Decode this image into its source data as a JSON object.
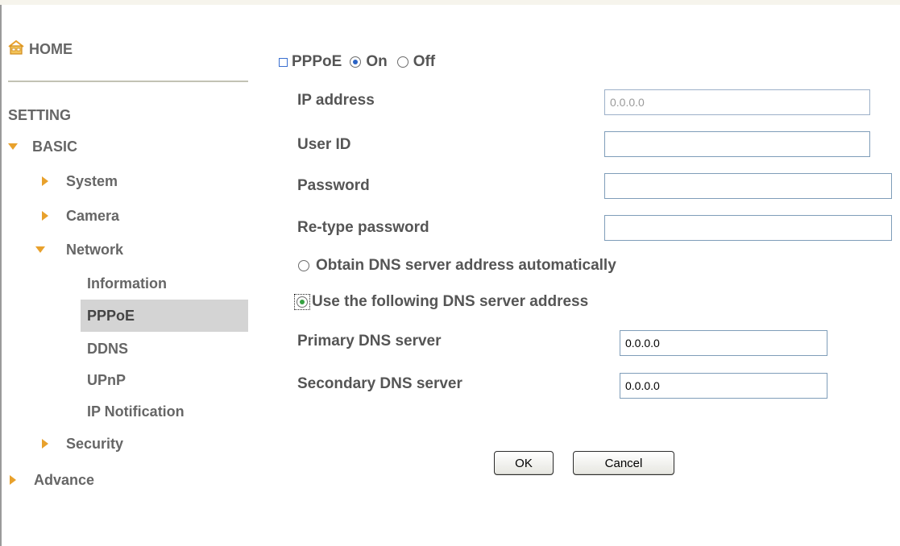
{
  "sidebar": {
    "home_label": "HOME",
    "section_title": "SETTING",
    "items": [
      {
        "label": "BASIC"
      },
      {
        "label": "System"
      },
      {
        "label": "Camera"
      },
      {
        "label": "Network"
      },
      {
        "label": "Information"
      },
      {
        "label": "PPPoE"
      },
      {
        "label": "DDNS"
      },
      {
        "label": "UPnP"
      },
      {
        "label": "IP Notification"
      },
      {
        "label": "Security"
      },
      {
        "label": "Advance"
      }
    ],
    "active_item": "PPPoE"
  },
  "form": {
    "title": "PPPoE",
    "on_label": "On",
    "off_label": "Off",
    "pppoe_state": "On",
    "ip_address": {
      "label": "IP address",
      "value": "0.0.0.0"
    },
    "user_id": {
      "label": "User ID",
      "value": ""
    },
    "password": {
      "label": "Password",
      "value": ""
    },
    "retype_password": {
      "label": "Re-type password",
      "value": ""
    },
    "dns_auto_label": "Obtain DNS server address automatically",
    "dns_manual_label": "Use the following DNS server address",
    "dns_mode": "manual",
    "primary_dns": {
      "label": "Primary DNS server",
      "value": "0.0.0.0"
    },
    "secondary_dns": {
      "label": "Secondary DNS server",
      "value": "0.0.0.0"
    },
    "ok_label": "OK",
    "cancel_label": "Cancel"
  },
  "colors": {
    "arrow": "#e8a12c",
    "active_bg": "#d4d4d4",
    "text": "#555555",
    "radio_selected": "#36a142"
  },
  "icons": {
    "home": "home-icon",
    "expanded": "triangle-down-icon",
    "collapsed": "triangle-right-icon"
  }
}
